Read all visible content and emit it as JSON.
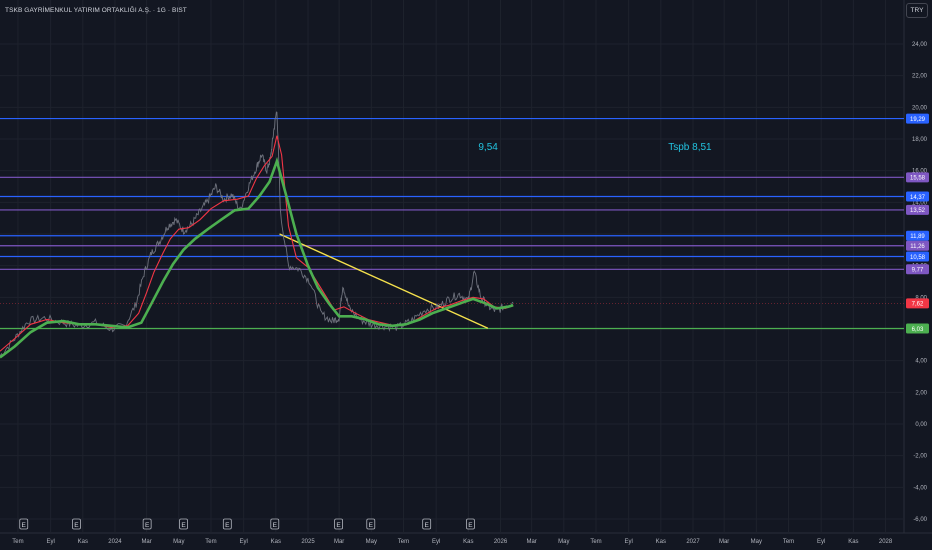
{
  "header": {
    "title": "TSKB GAYRİMENKUL YATIRIM ORTAKLIĞI A.Ş. · 1G · BIST",
    "currency_button": "TRY"
  },
  "annotations": [
    {
      "text": "9,54",
      "price": 17.45,
      "date": "2025-11-20"
    },
    {
      "text": "Tspb  8,51",
      "price": 17.45,
      "date": "2026-11-15"
    }
  ],
  "colors": {
    "background": "#131722",
    "blue": "#2962ff",
    "purple": "#7e57c2",
    "green": "#4caf50",
    "red": "#f23645",
    "yellow": "#f5e14c",
    "ma_fast": "#f23645",
    "ma_slow": "#4caf50",
    "candle": "#787b86"
  },
  "chart_data": {
    "type": "line",
    "title": "TSKB GAYRİMENKUL YATIRIM ORTAKLIĞI A.Ş. · 1G · BIST",
    "x_axis_labels": [
      "Tem",
      "Eyl",
      "Kas",
      "2024",
      "Mar",
      "May",
      "Tem",
      "Eyl",
      "Kas",
      "2025",
      "Mar",
      "May",
      "Tem",
      "Eyl",
      "Kas",
      "2026",
      "Mar",
      "May",
      "Tem",
      "Eyl",
      "Kas",
      "2027",
      "Mar",
      "May",
      "Tem",
      "Eyl",
      "Kas",
      "2028"
    ],
    "x_axis_dates": [
      "2023-07-01",
      "2023-09-01",
      "2023-11-01",
      "2024-01-01",
      "2024-03-01",
      "2024-05-01",
      "2024-07-01",
      "2024-09-01",
      "2024-11-01",
      "2025-01-01",
      "2025-03-01",
      "2025-05-01",
      "2025-07-01",
      "2025-09-01",
      "2025-11-01",
      "2026-01-01",
      "2026-03-01",
      "2026-05-01",
      "2026-07-01",
      "2026-09-01",
      "2026-11-01",
      "2027-01-01",
      "2027-03-01",
      "2027-05-01",
      "2027-07-01",
      "2027-09-01",
      "2027-11-01",
      "2028-01-01"
    ],
    "y_axis_ticks": [
      "24,00",
      "22,00",
      "20,00",
      "18,00",
      "16,00",
      "14,00",
      "12,00",
      "10,00",
      "8,00",
      "6,00",
      "4,00",
      "2,00",
      "0,00",
      "-2,00",
      "-4,00",
      "-6,00"
    ],
    "ylim": [
      -6.5,
      26.5
    ],
    "xlim": [
      "2023-05-28",
      "2028-02-05"
    ],
    "horizontal_levels": [
      {
        "label": "19,29",
        "value": 19.29,
        "color": "#2962ff"
      },
      {
        "label": "15,58",
        "value": 15.58,
        "color": "#7e57c2"
      },
      {
        "label": "14,37",
        "value": 14.37,
        "color": "#2962ff"
      },
      {
        "label": "13,52",
        "value": 13.52,
        "color": "#7e57c2"
      },
      {
        "label": "11,89",
        "value": 11.89,
        "color": "#2962ff"
      },
      {
        "label": "11,26",
        "value": 11.26,
        "color": "#7e57c2"
      },
      {
        "label": "10,58",
        "value": 10.58,
        "color": "#2962ff"
      },
      {
        "label": "9,77",
        "value": 9.77,
        "color": "#7e57c2"
      },
      {
        "label": "6,03",
        "value": 6.03,
        "color": "#4caf50"
      }
    ],
    "last_price": {
      "label": "7,62",
      "value": 7.62,
      "color": "#f23645"
    },
    "trendline": {
      "start": {
        "date": "2024-11-08",
        "price": 12.0
      },
      "end": {
        "date": "2025-12-08",
        "price": 6.05
      },
      "color": "#f5e14c"
    },
    "earnings_markers": {
      "label": "E",
      "dates": [
        "2023-07-12",
        "2023-10-20",
        "2024-03-02",
        "2024-05-10",
        "2024-08-01",
        "2024-10-30",
        "2025-02-28",
        "2025-04-30",
        "2025-08-14",
        "2025-11-05"
      ]
    },
    "series": [
      {
        "kind": "price",
        "x": [
          "2023-05-28",
          "2023-06-25",
          "2023-07-20",
          "2023-08-20",
          "2023-09-25",
          "2023-10-25",
          "2023-11-25",
          "2023-12-25",
          "2024-01-20",
          "2024-02-10",
          "2024-02-25",
          "2024-03-10",
          "2024-03-25",
          "2024-04-10",
          "2024-04-25",
          "2024-05-10",
          "2024-05-25",
          "2024-06-10",
          "2024-06-25",
          "2024-07-10",
          "2024-07-25",
          "2024-08-10",
          "2024-08-25",
          "2024-09-10",
          "2024-09-25",
          "2024-10-05",
          "2024-10-15",
          "2024-10-22",
          "2024-10-28",
          "2024-11-03",
          "2024-11-10",
          "2024-11-25",
          "2024-12-15",
          "2025-01-05",
          "2025-01-25",
          "2025-02-15",
          "2025-03-01",
          "2025-03-08",
          "2025-03-20",
          "2025-04-10",
          "2025-05-01",
          "2025-05-25",
          "2025-06-20",
          "2025-07-15",
          "2025-08-10",
          "2025-09-05",
          "2025-09-25",
          "2025-10-15",
          "2025-11-01",
          "2025-11-12",
          "2025-11-25",
          "2025-12-10",
          "2025-12-25",
          "2026-01-10",
          "2026-01-25"
        ],
        "y": [
          4.3,
          5.4,
          6.5,
          6.7,
          6.4,
          6.2,
          6.4,
          6.0,
          6.2,
          7.6,
          9.5,
          10.8,
          11.5,
          12.5,
          12.9,
          12.2,
          12.6,
          13.4,
          14.1,
          15.0,
          14.2,
          14.5,
          13.5,
          15.0,
          16.2,
          17.0,
          16.0,
          16.8,
          18.5,
          19.9,
          13.2,
          10.0,
          9.8,
          9.0,
          7.0,
          6.5,
          6.7,
          8.8,
          7.3,
          6.6,
          6.3,
          6.2,
          6.1,
          6.5,
          7.2,
          7.4,
          7.9,
          8.2,
          7.8,
          9.6,
          8.0,
          7.4,
          7.1,
          7.5,
          7.7
        ]
      },
      {
        "kind": "ma_fast",
        "x": [
          "2023-05-28",
          "2023-06-25",
          "2023-07-25",
          "2023-08-25",
          "2023-09-25",
          "2023-10-25",
          "2023-11-25",
          "2023-12-25",
          "2024-01-25",
          "2024-02-15",
          "2024-03-01",
          "2024-03-15",
          "2024-04-01",
          "2024-04-15",
          "2024-05-01",
          "2024-05-20",
          "2024-06-10",
          "2024-07-01",
          "2024-07-25",
          "2024-08-20",
          "2024-09-10",
          "2024-09-25",
          "2024-10-10",
          "2024-10-25",
          "2024-11-03",
          "2024-11-12",
          "2024-11-25",
          "2024-12-10",
          "2025-01-01",
          "2025-01-25",
          "2025-02-20",
          "2025-03-10",
          "2025-04-01",
          "2025-04-25",
          "2025-05-20",
          "2025-06-15",
          "2025-07-10",
          "2025-08-05",
          "2025-09-01",
          "2025-09-25",
          "2025-10-20",
          "2025-11-10",
          "2025-11-30",
          "2025-12-20",
          "2026-01-10",
          "2026-01-25"
        ],
        "y": [
          4.6,
          5.4,
          6.3,
          6.6,
          6.4,
          6.3,
          6.3,
          6.1,
          6.2,
          7.0,
          8.3,
          9.6,
          10.8,
          11.7,
          12.3,
          12.4,
          12.9,
          13.6,
          14.1,
          14.2,
          14.4,
          15.5,
          16.3,
          16.9,
          18.2,
          17.0,
          12.5,
          10.5,
          9.9,
          8.6,
          7.2,
          7.4,
          7.0,
          6.6,
          6.4,
          6.2,
          6.3,
          6.8,
          7.3,
          7.5,
          7.8,
          8.0,
          7.9,
          7.4,
          7.3,
          7.5
        ]
      },
      {
        "kind": "ma_slow",
        "x": [
          "2023-05-28",
          "2023-06-25",
          "2023-07-25",
          "2023-08-25",
          "2023-09-25",
          "2023-10-25",
          "2023-11-25",
          "2023-12-25",
          "2024-01-25",
          "2024-02-20",
          "2024-03-10",
          "2024-04-01",
          "2024-04-20",
          "2024-05-10",
          "2024-06-01",
          "2024-06-25",
          "2024-07-20",
          "2024-08-15",
          "2024-09-10",
          "2024-10-01",
          "2024-10-20",
          "2024-11-03",
          "2024-11-20",
          "2024-12-10",
          "2025-01-01",
          "2025-01-20",
          "2025-02-10",
          "2025-03-01",
          "2025-03-25",
          "2025-04-20",
          "2025-05-15",
          "2025-06-10",
          "2025-07-05",
          "2025-08-01",
          "2025-08-25",
          "2025-09-20",
          "2025-10-15",
          "2025-11-10",
          "2025-12-05",
          "2025-12-25",
          "2026-01-15",
          "2026-01-25"
        ],
        "y": [
          4.2,
          4.9,
          5.8,
          6.4,
          6.5,
          6.3,
          6.3,
          6.2,
          6.1,
          6.4,
          7.6,
          9.0,
          10.1,
          11.0,
          11.7,
          12.3,
          12.9,
          13.5,
          13.6,
          14.4,
          15.3,
          16.6,
          14.5,
          12.0,
          10.0,
          8.6,
          7.6,
          6.8,
          6.8,
          6.6,
          6.3,
          6.2,
          6.3,
          6.6,
          7.0,
          7.3,
          7.6,
          7.9,
          7.6,
          7.3,
          7.4,
          7.5
        ]
      }
    ]
  }
}
